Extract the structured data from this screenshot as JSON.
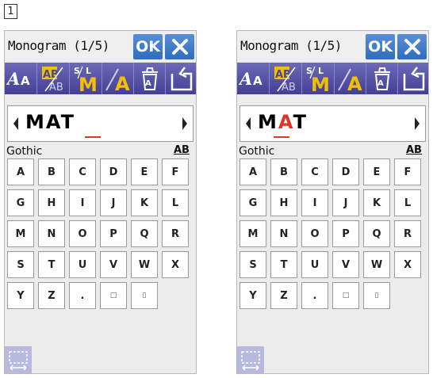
{
  "step_label": "1",
  "screens": [
    {
      "title": "Monogram (1/5)",
      "ok_label": "OK",
      "text_parts": [
        "M",
        "A",
        "T"
      ],
      "selected_index": -1,
      "font_name": "Gothic",
      "size_label": "AB"
    },
    {
      "title": "Monogram (1/5)",
      "ok_label": "OK",
      "text_parts": [
        "M",
        "A",
        "T"
      ],
      "selected_index": 1,
      "font_name": "Gothic",
      "size_label": "AB"
    }
  ],
  "keys": [
    [
      "A",
      "B",
      "C",
      "D",
      "E",
      "F"
    ],
    [
      "G",
      "H",
      "I",
      "J",
      "K",
      "L"
    ],
    [
      "M",
      "N",
      "O",
      "P",
      "Q",
      "R"
    ],
    [
      "S",
      "T",
      "U",
      "V",
      "W",
      "X"
    ],
    [
      "Y",
      "Z",
      ".",
      "□",
      "▯"
    ]
  ],
  "colors": {
    "accent": "#2f6cbf",
    "toolbar": "#4a4699",
    "highlight": "#f3c000",
    "selection": "#e0332a"
  },
  "icons": [
    "font-style-icon",
    "letter-spacing-icon",
    "size-m-icon",
    "italic-a-icon",
    "delete-icon",
    "back-icon",
    "frame-icon"
  ]
}
